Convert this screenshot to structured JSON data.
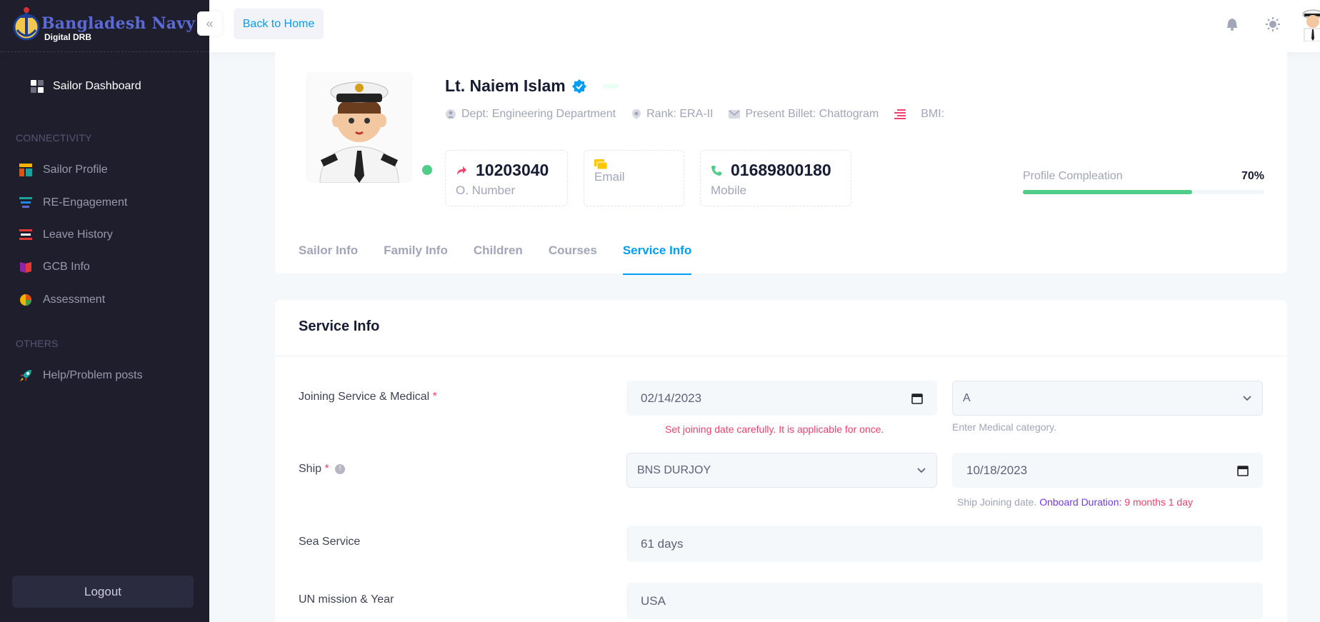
{
  "brand": {
    "name": "Bangladesh Navy",
    "subtitle": "Digital DRB"
  },
  "sidebar": {
    "dashboard_label": "Sailor Dashboard",
    "section_connectivity": "CONNECTIVITY",
    "section_others": "OTHERS",
    "items": [
      {
        "label": "Sailor Profile",
        "icon": "profile-icon"
      },
      {
        "label": "RE-Engagement",
        "icon": "engagement-icon"
      },
      {
        "label": "Leave History",
        "icon": "leave-icon"
      },
      {
        "label": "GCB Info",
        "icon": "book-icon"
      },
      {
        "label": "Assessment",
        "icon": "pie-chart-icon"
      }
    ],
    "help_label": "Help/Problem posts",
    "logout_label": "Logout"
  },
  "header": {
    "back_label": "Back to Home"
  },
  "profile": {
    "name": "Lt. Naiem Islam",
    "dept": "Dept: Engineering Department",
    "rank": "Rank: ERA-II",
    "billet": "Present Billet: Chattogram",
    "bmi": "BMI:",
    "o_number": "10203040",
    "o_number_label": "O. Number",
    "email_label": "Email",
    "mobile": "01689800180",
    "mobile_label": "Mobile",
    "completion_label": "Profile Compleation",
    "completion_text": "70%",
    "completion_value": 0.7
  },
  "tabs": [
    "Sailor Info",
    "Family Info",
    "Children",
    "Courses",
    "Service Info"
  ],
  "service": {
    "title": "Service Info",
    "joining_label": "Joining Service & Medical",
    "required_mark": "*",
    "joining_date": "02/14/2023",
    "joining_help": "Set joining date carefully. It is applicable for once.",
    "medical_value": "A",
    "medical_help": "Enter Medical category.",
    "ship_label": "Ship",
    "ship_value": "BNS DURJOY",
    "ship_date": "10/18/2023",
    "ship_help": "Ship Joining date.",
    "onboard_label": "Onboard Duration:",
    "onboard_value": "9 months 1 day",
    "sea_label": "Sea Service",
    "sea_value": "61 days",
    "un_label": "UN mission & Year",
    "un_value": "USA"
  },
  "colors": {
    "accent": "#009ef7",
    "danger": "#f1416c",
    "success": "#50cd89",
    "sidebar": "#1e1e2d",
    "brand": "#5b6bd6"
  }
}
